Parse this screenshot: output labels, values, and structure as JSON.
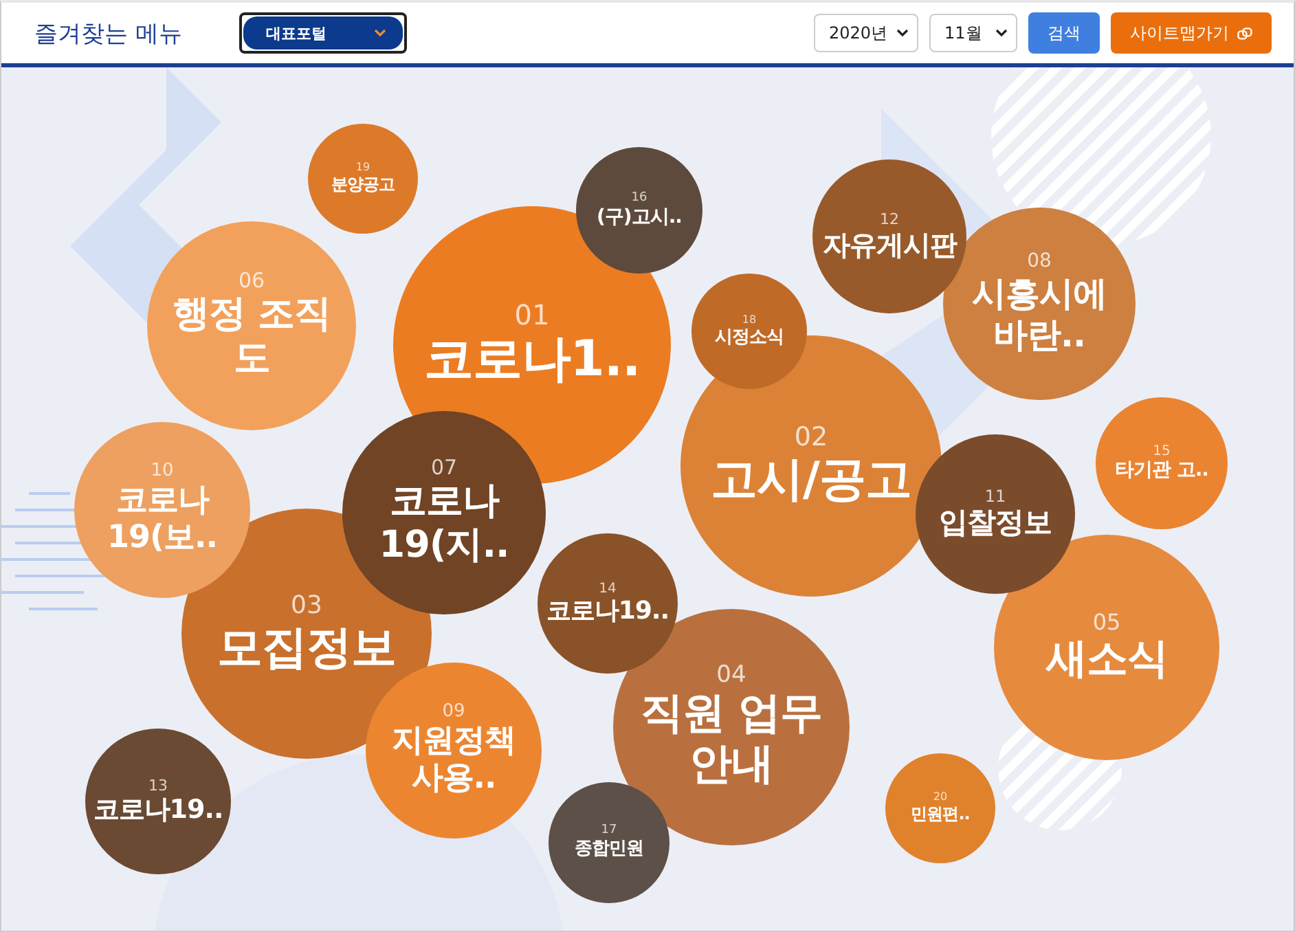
{
  "header": {
    "title": "즐겨찾는 메뉴",
    "portal_select": "대표포털",
    "year_select": "2020년",
    "month_select": "11월",
    "search_button": "검색",
    "sitemap_button": "사이트맵가기"
  },
  "bubbles": [
    {
      "number": "01",
      "label": "코로나1..",
      "color": "#ec7c22"
    },
    {
      "number": "02",
      "label": "고시/공고",
      "color": "#dc8236"
    },
    {
      "number": "03",
      "label": "모집정보",
      "color": "#c9702c"
    },
    {
      "number": "04",
      "label": "직원 업무\n안내",
      "color": "#b9703e"
    },
    {
      "number": "05",
      "label": "새소식",
      "color": "#e68a3e"
    },
    {
      "number": "06",
      "label": "행정 조직\n도",
      "color": "#f2a15c"
    },
    {
      "number": "07",
      "label": "코로나\n19(지..",
      "color": "#704425"
    },
    {
      "number": "08",
      "label": "시흥시에\n바란..",
      "color": "#cd8040"
    },
    {
      "number": "09",
      "label": "지원정책\n사용..",
      "color": "#ec8530"
    },
    {
      "number": "10",
      "label": "코로나\n19(보..",
      "color": "#eda060"
    },
    {
      "number": "11",
      "label": "입찰정보",
      "color": "#7a4c2c"
    },
    {
      "number": "12",
      "label": "자유게시판",
      "color": "#985a2a"
    },
    {
      "number": "13",
      "label": "코로나19..",
      "color": "#6a4a32"
    },
    {
      "number": "14",
      "label": "코로나19..",
      "color": "#8a5228"
    },
    {
      "number": "15",
      "label": "타기관 고..",
      "color": "#eb8430"
    },
    {
      "number": "16",
      "label": "(구)고시..",
      "color": "#5e4a3c"
    },
    {
      "number": "17",
      "label": "종합민원",
      "color": "#5c5048"
    },
    {
      "number": "18",
      "label": "시정소식",
      "color": "#c06a28"
    },
    {
      "number": "19",
      "label": "분양공고",
      "color": "#dc7a2a"
    },
    {
      "number": "20",
      "label": "민원편..",
      "color": "#e0822c"
    }
  ]
}
